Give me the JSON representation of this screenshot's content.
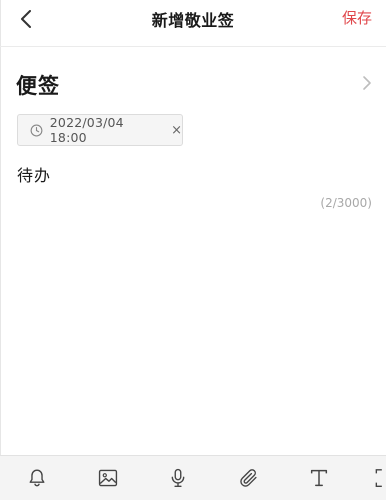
{
  "header": {
    "title": "新增敬业签",
    "save_label": "保存"
  },
  "category": {
    "label": "便签"
  },
  "reminder": {
    "datetime": "2022/03/04 18:00",
    "close_symbol": "×"
  },
  "note": {
    "content": "待办",
    "char_count": "(2/3000)"
  },
  "toolbar": {
    "items": [
      "bell-icon",
      "image-icon",
      "microphone-icon",
      "paperclip-icon",
      "text-format-icon",
      "expand-icon"
    ]
  },
  "colors": {
    "accent": "#e0474b",
    "toolbar_bg": "#f4f4f4"
  }
}
